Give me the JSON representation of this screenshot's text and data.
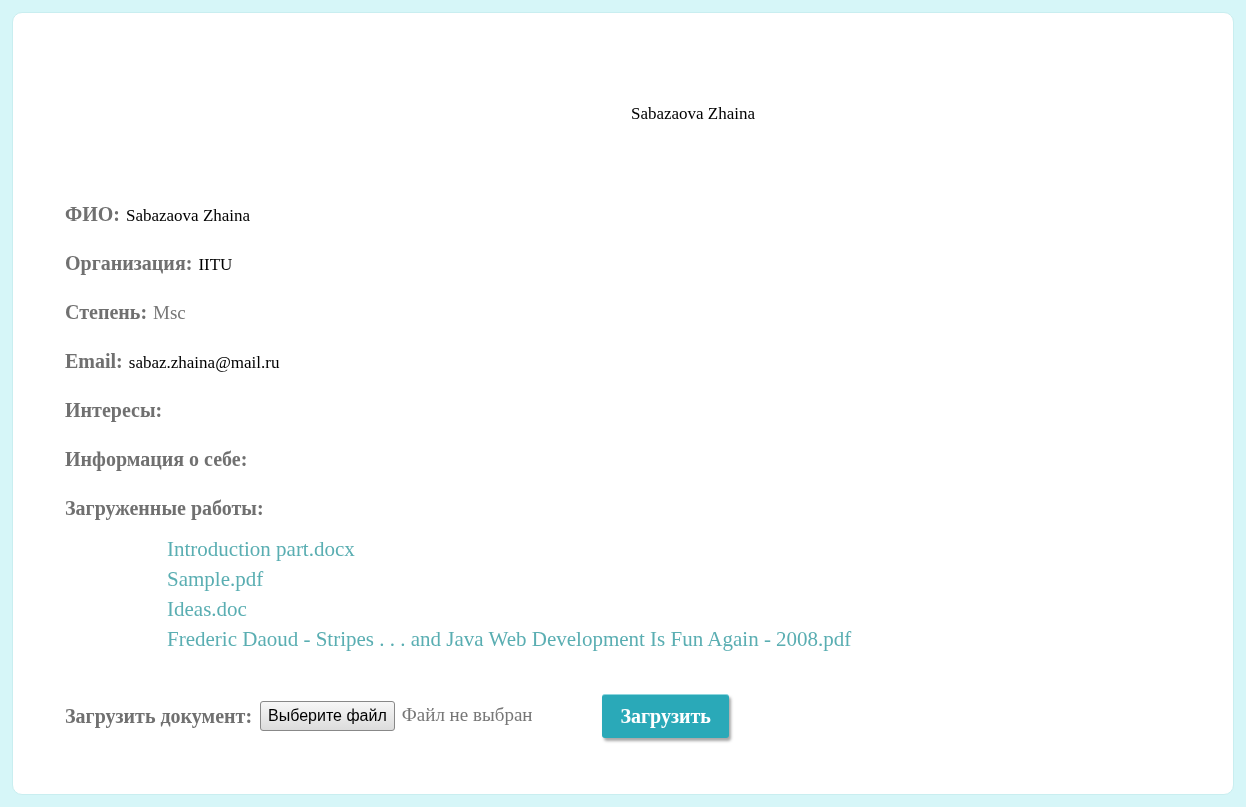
{
  "title": "Sabazaova Zhaina",
  "fields": [
    {
      "label": "ФИО:",
      "value": "Sabazaova Zhaina",
      "muted": false
    },
    {
      "label": "Организация:",
      "value": "IITU",
      "muted": false
    },
    {
      "label": "Степень:",
      "value": "Msc",
      "muted": true
    },
    {
      "label": "Email:",
      "value": "sabaz.zhaina@mail.ru",
      "muted": false
    },
    {
      "label": "Интересы:"
    },
    {
      "label": "Информация о себе:"
    },
    {
      "label": "Загруженные работы:"
    }
  ],
  "files": [
    "Introduction part.docx",
    "Sample.pdf",
    "Ideas.doc",
    "Frederic Daoud - Stripes . . . and Java Web Development Is Fun Again - 2008.pdf"
  ],
  "upload": {
    "label": "Загрузить документ:",
    "choose_button": "Выберите файл",
    "file_status": "Файл не выбран",
    "submit_button": "Загрузить"
  }
}
